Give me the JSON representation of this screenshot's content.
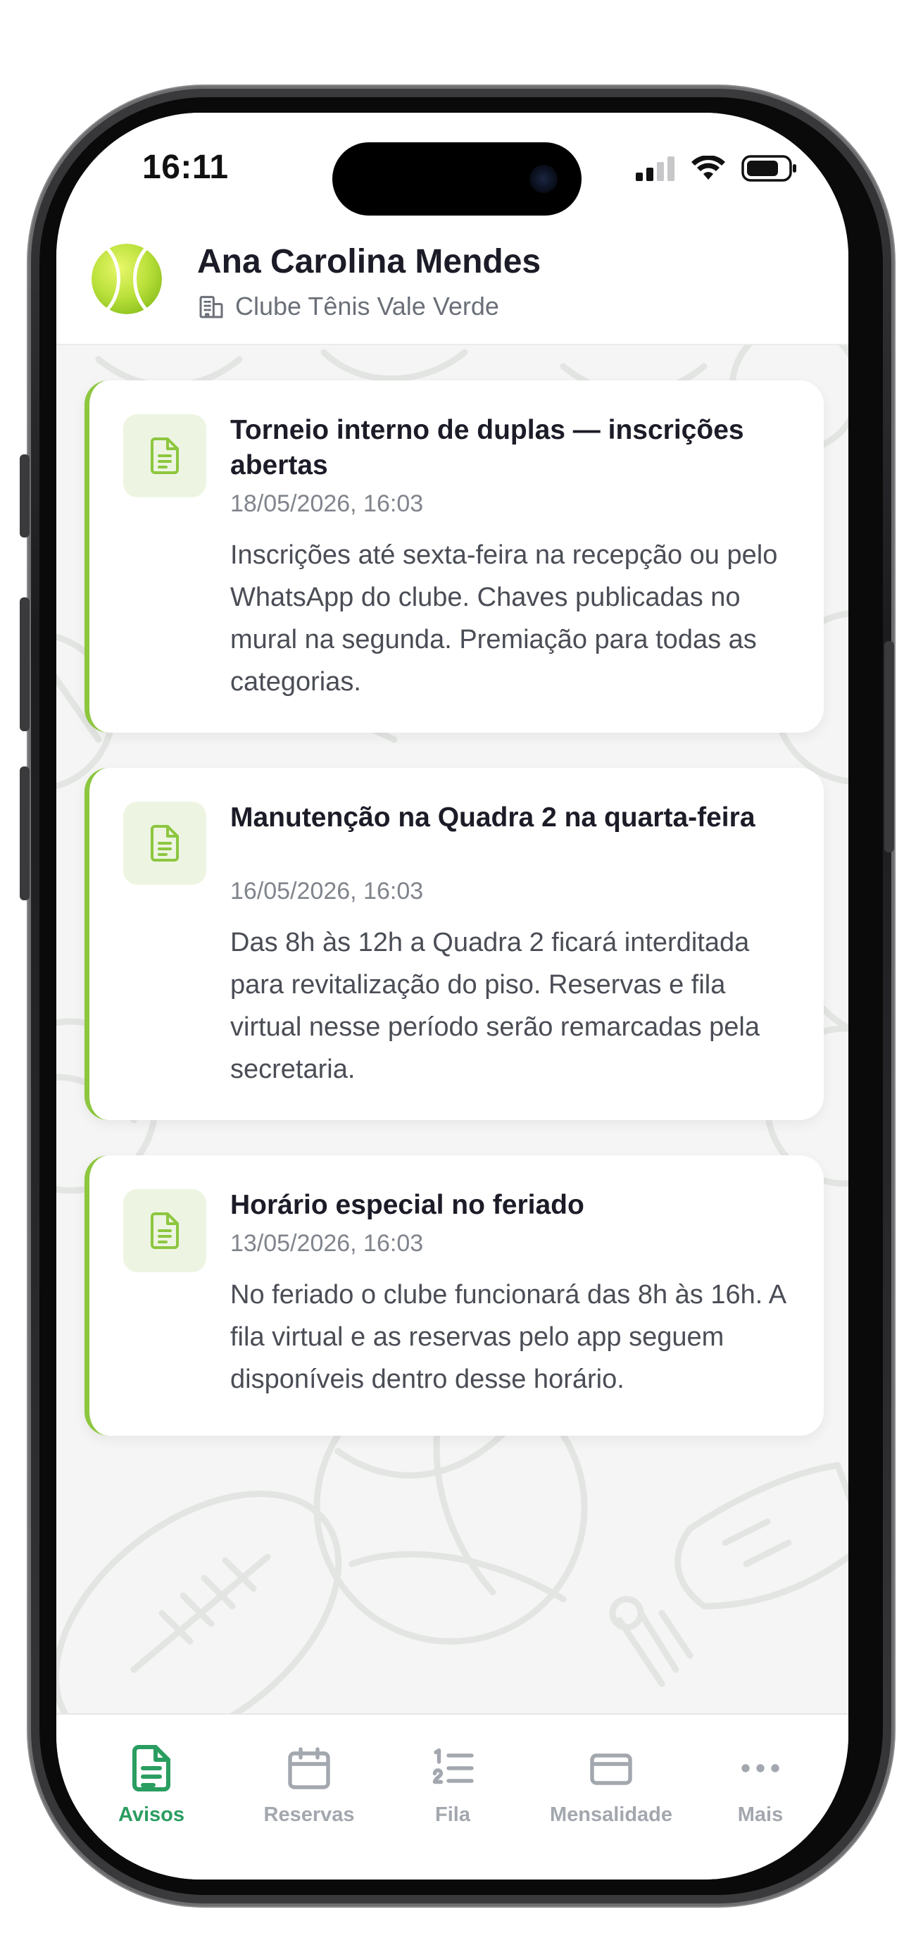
{
  "status": {
    "time": "16:11"
  },
  "header": {
    "user_name": "Ana Carolina Mendes",
    "club_name": "Clube Tênis Vale Verde",
    "avatar_icon": "tennis-ball-icon",
    "club_icon": "building-icon"
  },
  "notices": [
    {
      "title": "Torneio interno de duplas — inscrições abertas",
      "date": "18/05/2026, 16:03",
      "body": "Inscrições até sexta-feira na recepção ou pelo WhatsApp do clube. Chaves publicadas no mural na segunda. Premiação para todas as categorias.",
      "icon": "document-icon"
    },
    {
      "title": "Manutenção na Quadra 2 na quarta-feira",
      "date": "16/05/2026, 16:03",
      "body": "Das 8h às 12h a Quadra 2 ficará interditada para revitalização do piso. Reservas e fila virtual nesse período serão remarcadas pela secretaria.",
      "icon": "document-icon"
    },
    {
      "title": "Horário especial no feriado",
      "date": "13/05/2026, 16:03",
      "body": "No feriado o clube funcionará das 8h às 16h. A fila virtual e as reservas pelo app seguem disponíveis dentro desse horário.",
      "icon": "document-icon"
    }
  ],
  "tabs": [
    {
      "label": "Avisos",
      "icon": "document-icon",
      "active": true
    },
    {
      "label": "Reservas",
      "icon": "calendar-icon",
      "active": false
    },
    {
      "label": "Fila",
      "icon": "numbered-list-icon",
      "active": false
    },
    {
      "label": "Mensalidade",
      "icon": "credit-card-icon",
      "active": false
    },
    {
      "label": "Mais",
      "icon": "more-dots-icon",
      "active": false
    }
  ],
  "colors": {
    "accent": "#8dc63f",
    "active_tab": "#2a9d60",
    "inactive_tab": "#a3a7ae"
  }
}
